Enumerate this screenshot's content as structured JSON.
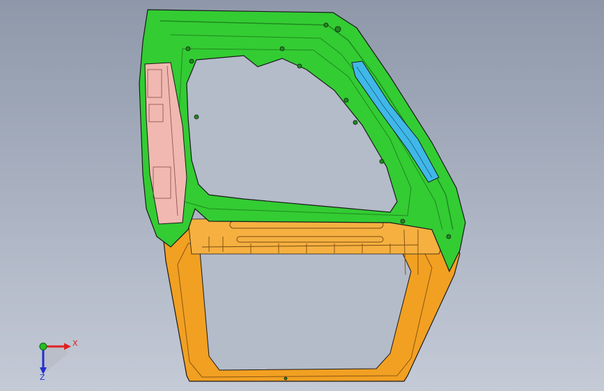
{
  "viewport": {
    "colors": {
      "background_top": "#8e98a9",
      "background_bottom": "#c4cad6",
      "frame_upper": "#33cc33",
      "frame_upper_dark": "#1e8a1e",
      "frame_lower": "#f2a022",
      "frame_lower_dark": "#b06a10",
      "hinge_reinforcement": "#f0b8b0",
      "belt_reinforcement": "#3fb8e8",
      "edge_line": "#1a1a1a"
    }
  },
  "triad": {
    "x_label": "X",
    "z_label": "Z",
    "colors": {
      "x_axis": "#e02020",
      "y_axis": "#20c020",
      "z_axis": "#2030d0"
    }
  }
}
